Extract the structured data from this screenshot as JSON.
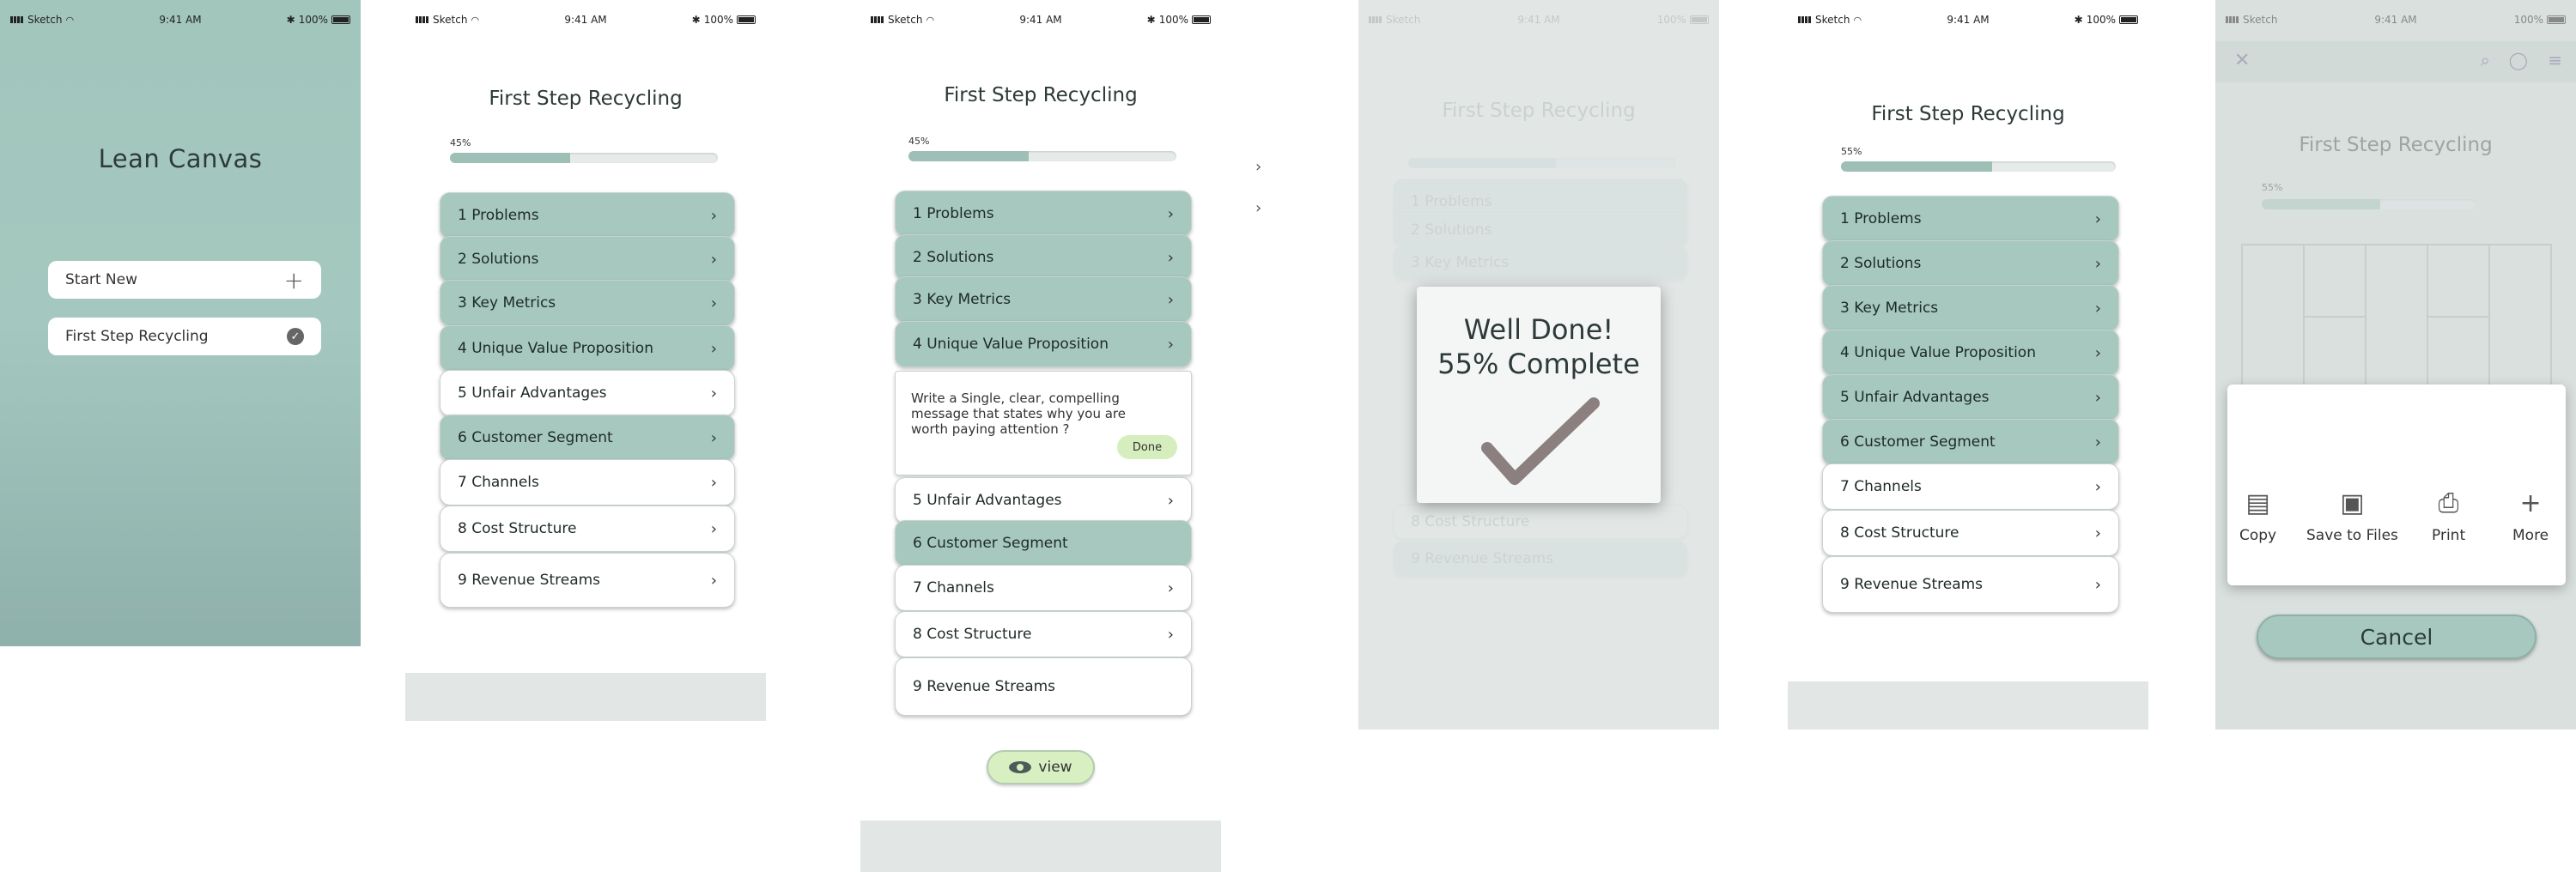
{
  "status": {
    "carrier": "Sketch",
    "time": "9:41 AM",
    "battery": "100%"
  },
  "screen1": {
    "title": "Lean Canvas",
    "start_new": "Start New",
    "project": "First Step Recycling"
  },
  "app_title": "First Step Recycling",
  "progress_a": {
    "label": "45%",
    "value": 0.45
  },
  "progress_b": {
    "label": "55%",
    "value": 0.55
  },
  "items": [
    "1 Problems",
    "2 Solutions",
    "3 Key Metrics",
    "4 Unique Value Proposition",
    "5 Unfair Advantages",
    "6 Customer Segment",
    "7 Channels",
    "8 Cost Structure",
    "9 Revenue Streams"
  ],
  "expand": {
    "text": "Write a Single, clear, compelling message that states why you are worth paying attention ?",
    "done": "Done"
  },
  "view_label": "view",
  "modal": {
    "line1": "Well Done!",
    "line2": "55% Complete"
  },
  "share": {
    "copy": "Copy",
    "save": "Save to Files",
    "print": "Print",
    "more": "More",
    "cancel": "Cancel"
  },
  "colors": {
    "teal": "#a6c8be",
    "progress": "#9ebfb6",
    "done_green": "#d6edbe",
    "bg_bar": "#e2e6e5"
  }
}
